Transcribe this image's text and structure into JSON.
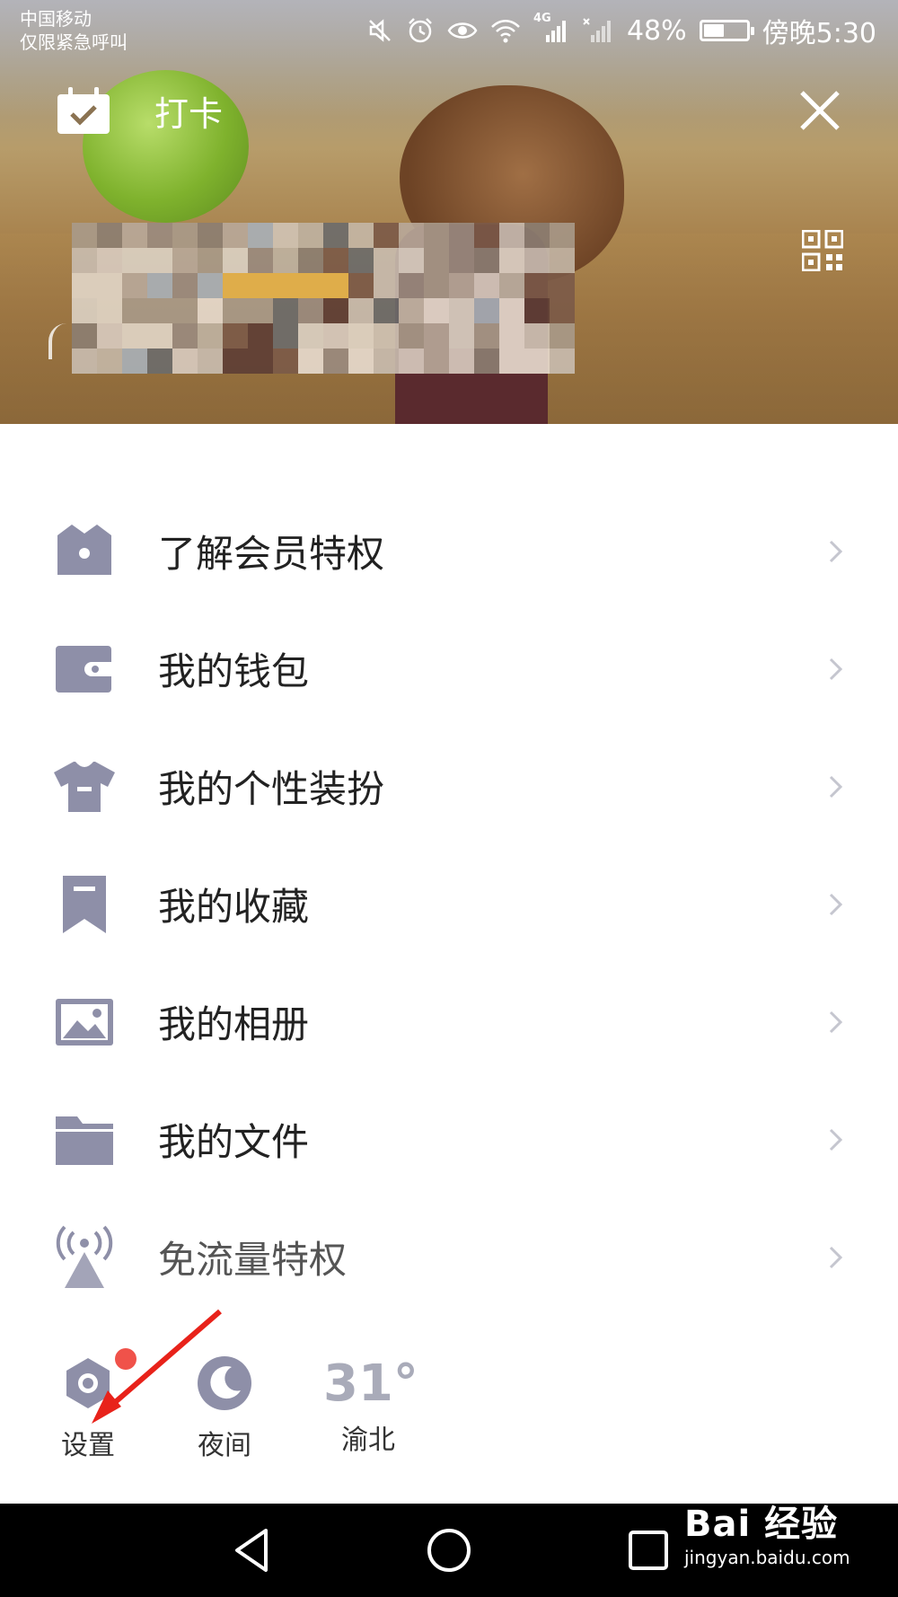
{
  "status_bar": {
    "carrier_line1": "中国移动",
    "carrier_line2": "仅限紧急呼叫",
    "network_label": "4G",
    "battery_percent_text": "48%",
    "battery_level": 0.48,
    "time": "傍晚5:30",
    "icons": [
      "mute-icon",
      "alarm-icon",
      "eye-icon",
      "wifi-icon",
      "signal-icon",
      "no-signal-icon",
      "battery-icon"
    ]
  },
  "header": {
    "checkin_label": "打卡",
    "close_icon": "close-icon",
    "qr_icon": "qr-code-icon",
    "profile_blurred": true
  },
  "menu": {
    "items": [
      {
        "label": "了解会员特权",
        "icon": "crown-icon"
      },
      {
        "label": "我的钱包",
        "icon": "wallet-icon"
      },
      {
        "label": "我的个性装扮",
        "icon": "tshirt-icon"
      },
      {
        "label": "我的收藏",
        "icon": "bookmark-icon"
      },
      {
        "label": "我的相册",
        "icon": "photo-icon"
      },
      {
        "label": "我的文件",
        "icon": "folder-icon"
      },
      {
        "label": "免流量特权",
        "icon": "broadcast-icon"
      }
    ]
  },
  "bottom": {
    "settings_label": "设置",
    "night_label": "夜间",
    "temperature": "31°",
    "city": "渝北"
  },
  "watermark": {
    "brand": "Bai  经验",
    "url": "jingyan.baidu.com"
  },
  "colors": {
    "icon_gray": "#8e8fa8",
    "text_dark": "#222222",
    "chevron": "#c5c6cf",
    "badge_red": "#f0524a",
    "arrow_red": "#e8221a"
  }
}
